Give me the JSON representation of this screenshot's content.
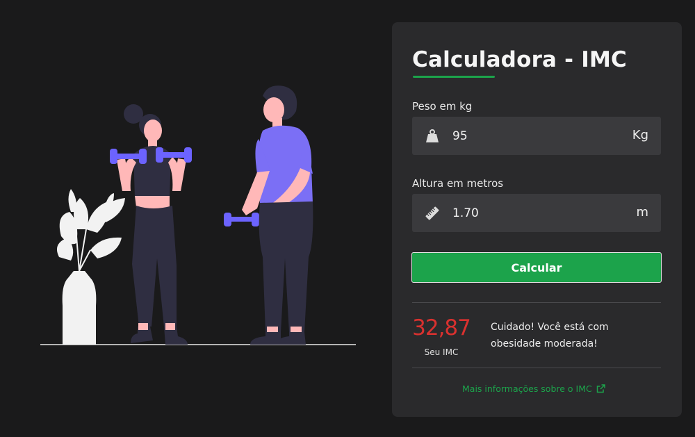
{
  "card": {
    "title": "Calculadora - IMC",
    "weight": {
      "label": "Peso em kg",
      "value": "95",
      "unit": "Kg",
      "icon": "weight-icon"
    },
    "height": {
      "label": "Altura em metros",
      "value": "1.70",
      "unit": "m",
      "icon": "ruler-icon"
    },
    "calculate_label": "Calcular",
    "result": {
      "value": "32,87",
      "caption": "Seu IMC",
      "message": "Cuidado! Você está com obesidade moderada!"
    },
    "more_info_link": "Mais informações sobre o IMC",
    "more_info_icon": "external-link-icon"
  },
  "colors": {
    "background": "#1a1a1b",
    "card": "#2a2a2c",
    "accent": "#1ca34b",
    "result": "#d9312f",
    "dumbbell": "#6c63ff",
    "shirt": "#7b6ff5"
  }
}
